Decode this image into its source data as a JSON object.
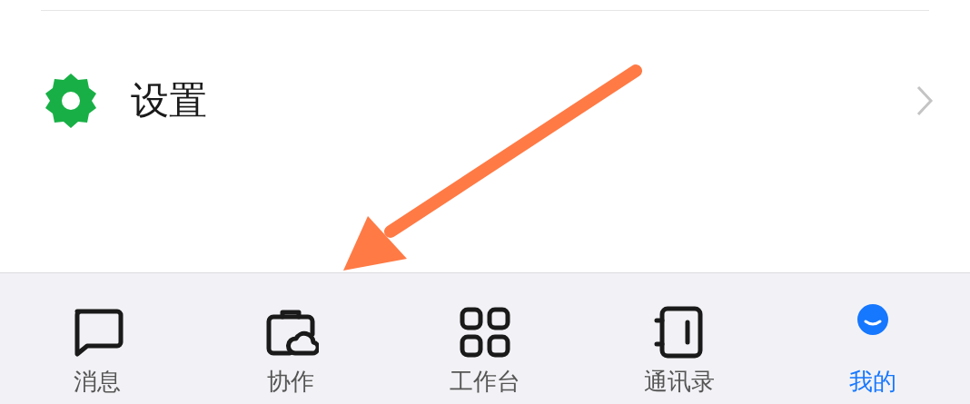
{
  "menu_item": {
    "label": "设置"
  },
  "tab_bar": [
    {
      "kind": "message",
      "label": "消息",
      "selected": false
    },
    {
      "kind": "collab",
      "label": "协作",
      "selected": false
    },
    {
      "kind": "workbench",
      "label": "工作台",
      "selected": false
    },
    {
      "kind": "contacts",
      "label": "通讯录",
      "selected": false
    },
    {
      "kind": "me",
      "label": "我的",
      "selected": true
    }
  ]
}
